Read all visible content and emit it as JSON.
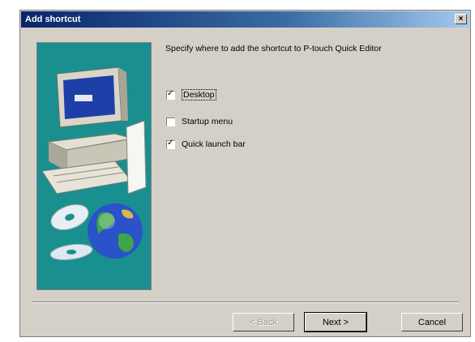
{
  "window": {
    "title": "Add shortcut",
    "close_glyph": "×"
  },
  "art": {
    "icons": [
      "computer-icon",
      "cd-discs-icon",
      "globe-icon"
    ],
    "background_color": "#1a8f8f"
  },
  "instruction": "Specify where to add the shortcut to P-touch Quick Editor",
  "options": [
    {
      "label": "Desktop",
      "checked": true
    },
    {
      "label": "Startup menu",
      "checked": false
    },
    {
      "label": "Quick launch bar",
      "checked": true
    }
  ],
  "checkmark_glyph": "✓",
  "buttons": {
    "back": "< Back",
    "next": "Next >",
    "cancel": "Cancel"
  }
}
